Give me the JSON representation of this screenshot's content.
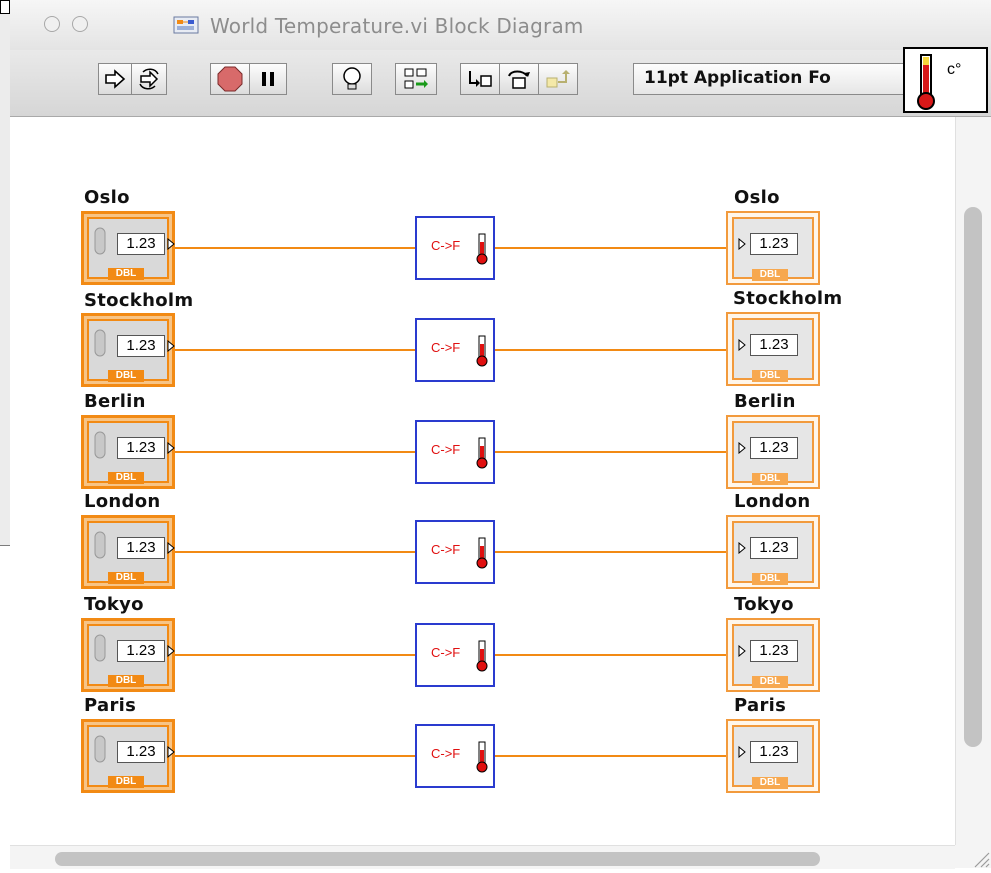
{
  "window": {
    "title": "World Temperature.vi Block Diagram"
  },
  "toolbar": {
    "font_selector": "11pt Application Fo"
  },
  "vi_icon": {
    "unit": "c°"
  },
  "diagram": {
    "numeric_display": "1.23",
    "datatype": "DBL",
    "subvi_label": "C->F",
    "rows": [
      {
        "control_label": "Oslo",
        "indicator_label": "Oslo"
      },
      {
        "control_label": "Stockholm",
        "indicator_label": "Stockholm"
      },
      {
        "control_label": "Berlin",
        "indicator_label": "Berlin"
      },
      {
        "control_label": "London",
        "indicator_label": "London"
      },
      {
        "control_label": "Tokyo",
        "indicator_label": "Tokyo"
      },
      {
        "control_label": "Paris",
        "indicator_label": "Paris"
      }
    ]
  },
  "colors": {
    "wire": "#f28a14",
    "subvi_border": "#2a3bcf",
    "subvi_text": "#e01010"
  }
}
